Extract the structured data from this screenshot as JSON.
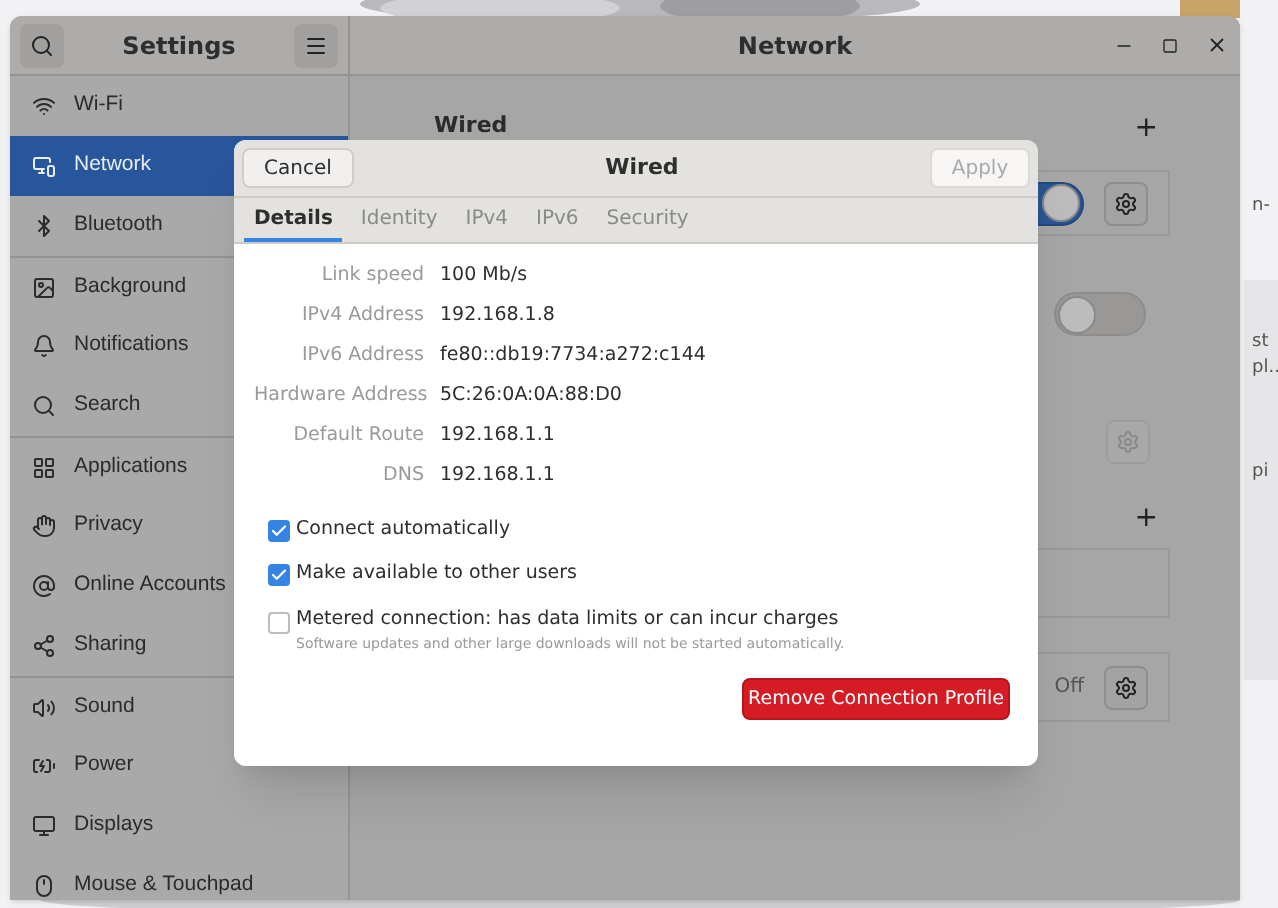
{
  "window": {
    "sidebar_title": "Settings",
    "main_title": "Network"
  },
  "sidebar": {
    "items": [
      {
        "label": "Wi-Fi",
        "selected": false,
        "divider_above": false
      },
      {
        "label": "Network",
        "selected": true,
        "divider_above": false
      },
      {
        "label": "Bluetooth",
        "selected": false,
        "divider_above": false
      },
      {
        "label": "Background",
        "selected": false,
        "divider_above": true
      },
      {
        "label": "Notifications",
        "selected": false,
        "divider_above": false
      },
      {
        "label": "Search",
        "selected": false,
        "divider_above": false
      },
      {
        "label": "Applications",
        "selected": false,
        "divider_above": true
      },
      {
        "label": "Privacy",
        "selected": false,
        "divider_above": false
      },
      {
        "label": "Online Accounts",
        "selected": false,
        "divider_above": false
      },
      {
        "label": "Sharing",
        "selected": false,
        "divider_above": false
      },
      {
        "label": "Sound",
        "selected": false,
        "divider_above": true
      },
      {
        "label": "Power",
        "selected": false,
        "divider_above": false
      },
      {
        "label": "Displays",
        "selected": false,
        "divider_above": false
      },
      {
        "label": "Mouse & Touchpad",
        "selected": false,
        "divider_above": false
      }
    ]
  },
  "main": {
    "heading": "Wired",
    "add_1": "+",
    "switch_1_on": true,
    "switch_2_on": false,
    "gear_3_disabled": true,
    "add_2": "+",
    "status": "Off"
  },
  "desktop_labels": [
    "n-",
    "st",
    "pl..",
    "pi"
  ],
  "dialog": {
    "cancel": "Cancel",
    "title": "Wired",
    "apply": "Apply",
    "apply_disabled": true,
    "tabs": [
      {
        "label": "Details",
        "selected": true
      },
      {
        "label": "Identity",
        "selected": false
      },
      {
        "label": "IPv4",
        "selected": false
      },
      {
        "label": "IPv6",
        "selected": false
      },
      {
        "label": "Security",
        "selected": false
      }
    ],
    "details": [
      {
        "label": "Link speed",
        "value": "100 Mb/s"
      },
      {
        "label": "IPv4 Address",
        "value": "192.168.1.8"
      },
      {
        "label": "IPv6 Address",
        "value": "fe80::db19:7734:a272:c144"
      },
      {
        "label": "Hardware Address",
        "value": "5C:26:0A:0A:88:D0"
      },
      {
        "label": "Default Route",
        "value": "192.168.1.1"
      },
      {
        "label": "DNS",
        "value": "192.168.1.1"
      }
    ],
    "options": [
      {
        "label": "Connect automatically",
        "checked": true
      },
      {
        "label": "Make available to other users",
        "checked": true
      },
      {
        "label": "Metered connection: has data limits or can incur charges",
        "hint": "Software updates and other large downloads will not be started automatically.",
        "checked": false
      }
    ],
    "remove": "Remove Connection Profile"
  }
}
